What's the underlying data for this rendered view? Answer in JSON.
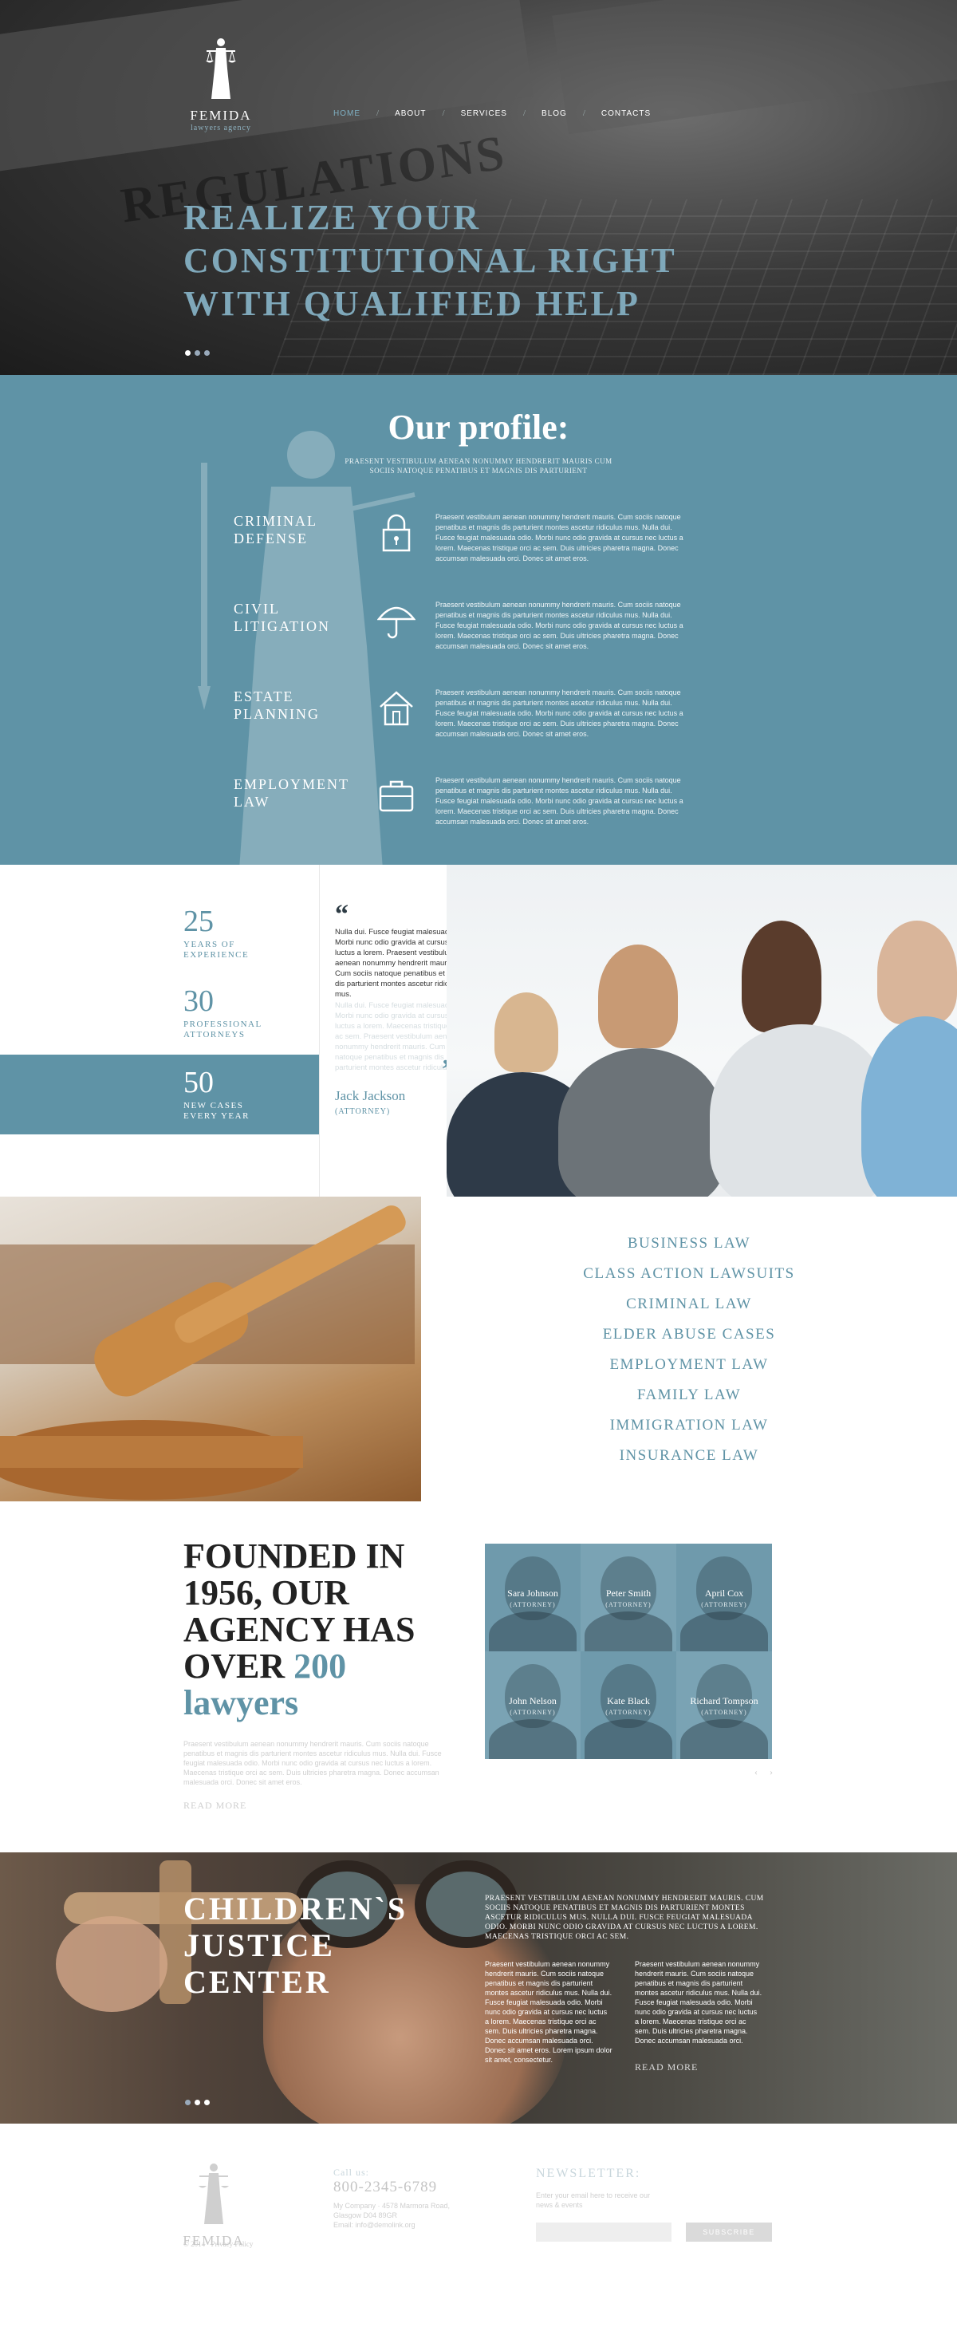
{
  "brand": {
    "name": "FEMIDA",
    "tagline": "lawyers agency"
  },
  "nav": {
    "items": [
      {
        "label": "HOME",
        "active": true
      },
      {
        "label": "ABOUT"
      },
      {
        "label": "SERVICES"
      },
      {
        "label": "BLOG"
      },
      {
        "label": "CONTACTS"
      }
    ]
  },
  "hero": {
    "background_text": "REGULATIONS",
    "title_line1": "REALIZE YOUR",
    "title_line2": "CONSTITUTIONAL RIGHT",
    "title_line3": "WITH QUALIFIED HELP",
    "slides": 3,
    "active_slide": 1
  },
  "profile": {
    "title": "Our profile:",
    "subtitle": "PRAESENT VESTIBULUM AENEAN NONUMMY HENDRERIT MAURIS CUM SOCIIS NATOQUE PENATIBUS ET MAGNIS DIS PARTURIENT",
    "services": [
      {
        "name_line1": "CRIMINAL",
        "name_line2": "DEFENSE",
        "icon": "lock-icon",
        "text": "Praesent vestibulum aenean nonummy hendrerit mauris. Cum sociis natoque penatibus et magnis dis parturient montes ascetur ridiculus mus. Nulla dui. Fusce feugiat malesuada odio. Morbi nunc odio gravida at cursus nec luctus a lorem. Maecenas tristique orci ac sem. Duis ultricies pharetra magna. Donec accumsan malesuada orci. Donec sit amet eros."
      },
      {
        "name_line1": "CIVIL",
        "name_line2": "LITIGATION",
        "icon": "umbrella-icon",
        "text": "Praesent vestibulum aenean nonummy hendrerit mauris. Cum sociis natoque penatibus et magnis dis parturient montes ascetur ridiculus mus. Nulla dui. Fusce feugiat malesuada odio. Morbi nunc odio gravida at cursus nec luctus a lorem. Maecenas tristique orci ac sem. Duis ultricies pharetra magna. Donec accumsan malesuada orci. Donec sit amet eros."
      },
      {
        "name_line1": "ESTATE",
        "name_line2": "PLANNING",
        "icon": "house-icon",
        "text": "Praesent vestibulum aenean nonummy hendrerit mauris. Cum sociis natoque penatibus et magnis dis parturient montes ascetur ridiculus mus. Nulla dui. Fusce feugiat malesuada odio. Morbi nunc odio gravida at cursus nec luctus a lorem. Maecenas tristique orci ac sem. Duis ultricies pharetra magna. Donec accumsan malesuada orci. Donec sit amet eros."
      },
      {
        "name_line1": "EMPLOYMENT",
        "name_line2": "LAW",
        "icon": "briefcase-icon",
        "text": "Praesent vestibulum aenean nonummy hendrerit mauris. Cum sociis natoque penatibus et magnis dis parturient montes ascetur ridiculus mus. Nulla dui. Fusce feugiat malesuada odio. Morbi nunc odio gravida at cursus nec luctus a lorem. Maecenas tristique orci ac sem. Duis ultricies pharetra magna. Donec accumsan malesuada orci. Donec sit amet eros."
      }
    ]
  },
  "stats": [
    {
      "number": "25",
      "label_line1": "YEARS OF",
      "label_line2": "EXPERIENCE"
    },
    {
      "number": "30",
      "label_line1": "PROFESSIONAL",
      "label_line2": "ATTORNEYS"
    },
    {
      "number": "50",
      "label_line1": "NEW CASES",
      "label_line2": "EVERY YEAR"
    }
  ],
  "testimonial": {
    "quote": "Nulla dui. Fusce feugiat malesuada odio. Morbi nunc odio gravida at cursus nec luctus a lorem. Praesent vestibulum aenean nonummy hendrerit mauris. Cum sociis natoque penatibus et magnis dis parturient montes ascetur ridiculus mus.",
    "quote_faded": "Nulla dui. Fusce feugiat malesuada odio. Morbi nunc odio gravida at cursus nec luctus a lorem. Maecenas tristique orci ac sem. Praesent vestibulum aenean nonummy hendrerit mauris. Cum sociis natoque penatibus et magnis dis parturient montes ascetur ridiculus mus.",
    "author": "Jack Jackson",
    "role": "(ATTORNEY)"
  },
  "practice_areas": [
    "BUSINESS LAW",
    "CLASS ACTION LAWSUITS",
    "CRIMINAL LAW",
    "ELDER ABUSE CASES",
    "EMPLOYMENT LAW",
    "FAMILY LAW",
    "IMMIGRATION LAW",
    "INSURANCE LAW"
  ],
  "founded": {
    "line1": "FOUNDED IN",
    "line2": "1956, OUR",
    "line3": "AGENCY HAS",
    "line4_prefix": "OVER ",
    "line4_highlight": "200",
    "line5": "lawyers",
    "body": "Praesent vestibulum aenean nonummy hendrerit mauris. Cum sociis natoque penatibus et magnis dis parturient montes ascetur ridiculus mus. Nulla dui. Fusce feugiat malesuada odio. Morbi nunc odio gravida at cursus nec luctus a lorem. Maecenas tristique orci ac sem. Duis ultricies pharetra magna. Donec accumsan malesuada orci. Donec sit amet eros.",
    "read_more": "READ MORE",
    "attorneys": [
      {
        "name": "Sara Johnson",
        "role": "(ATTORNEY)"
      },
      {
        "name": "Peter Smith",
        "role": "(ATTORNEY)"
      },
      {
        "name": "April Cox",
        "role": "(ATTORNEY)"
      },
      {
        "name": "John Nelson",
        "role": "(ATTORNEY)"
      },
      {
        "name": "Kate Black",
        "role": "(ATTORNEY)"
      },
      {
        "name": "Richard Tompson",
        "role": "(ATTORNEY)"
      }
    ],
    "arrows": "‹ ›"
  },
  "children": {
    "title_line1": "CHILDREN`S",
    "title_line2": "JUSTICE",
    "title_line3": "CENTER",
    "intro": "PRAESENT VESTIBULUM AENEAN NONUMMY HENDRERIT MAURIS. CUM SOCIIS NATOQUE PENATIBUS ET MAGNIS DIS PARTURIENT MONTES ASCETUR RIDICULUS MUS. NULLA DUI. FUSCE FEUGIAT MALESUADA ODIO. MORBI NUNC ODIO GRAVIDA AT CURSUS NEC LUCTUS A LOREM. MAECENAS TRISTIQUE ORCI AC SEM.",
    "col1": "Praesent vestibulum aenean nonummy hendrerit mauris. Cum sociis natoque penatibus et magnis dis parturient montes ascetur ridiculus mus. Nulla dui. Fusce feugiat malesuada odio. Morbi nunc odio gravida at cursus nec luctus a lorem. Maecenas tristique orci ac sem. Duis ultricies pharetra magna. Donec accumsan malesuada orci. Donec sit amet eros. Lorem ipsum dolor sit amet, consectetur.",
    "col2": "Praesent vestibulum aenean nonummy hendrerit mauris. Cum sociis natoque penatibus et magnis dis parturient montes ascetur ridiculus mus. Nulla dui. Fusce feugiat malesuada odio. Morbi nunc odio gravida at cursus nec luctus a lorem. Maecenas tristique orci ac sem. Duis ultricies pharetra magna. Donec accumsan malesuada orci.",
    "read_more": "READ MORE",
    "slides": 3,
    "active_slide": 1
  },
  "footer": {
    "brand": "FEMIDA",
    "copyright": "© 2014 · Privacy Policy",
    "call_label": "Call us:",
    "phone": "800-2345-6789",
    "address_line1": "My Company · 4578 Marmora Road,",
    "address_line2": "Glasgow D04 89GR",
    "email": "Email: info@demolink.org",
    "newsletter_title": "NEWSLETTER:",
    "newsletter_text_line1": "Enter your email here to receive our",
    "newsletter_text_line2": "news & events",
    "email_value": "",
    "subscribe": "SUBSCRIBE"
  },
  "colors": {
    "accent": "#5f93a6",
    "dark": "#222222",
    "hero_bg": "#2e2e2e"
  }
}
